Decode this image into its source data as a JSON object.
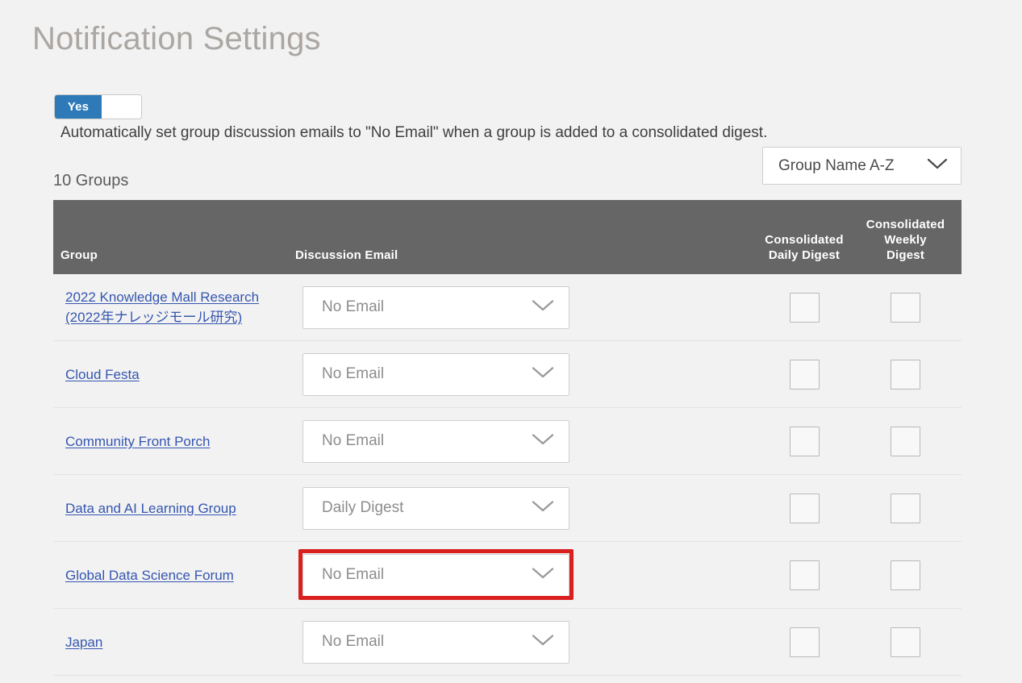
{
  "page": {
    "title": "Notification Settings"
  },
  "auto_setting": {
    "toggle_label": "Yes",
    "toggle_state": "on",
    "description": "Automatically set group discussion emails to \"No Email\" when a group is added to a consolidated digest."
  },
  "sort": {
    "selected": "Group Name A-Z",
    "icon": "chevron-down-icon"
  },
  "summary": {
    "count_label": "10 Groups"
  },
  "table": {
    "headers": {
      "group": "Group",
      "discussion_email": "Discussion Email",
      "consolidated_daily_digest": "Consolidated\nDaily Digest",
      "consolidated_daily_digest_line1": "Consolidated",
      "consolidated_daily_digest_line2": "Daily Digest",
      "consolidated_weekly_digest_line1": "Consolidated",
      "consolidated_weekly_digest_line2": "Weekly",
      "consolidated_weekly_digest_line3": "Digest"
    },
    "rows": [
      {
        "group": "2022 Knowledge Mall Research (2022年ナレッジモール研究)",
        "discussion_email": "No Email",
        "daily_digest_checked": false,
        "weekly_digest_checked": false,
        "highlighted": false
      },
      {
        "group": "Cloud Festa",
        "discussion_email": "No Email",
        "daily_digest_checked": false,
        "weekly_digest_checked": false,
        "highlighted": false
      },
      {
        "group": "Community Front Porch",
        "discussion_email": "No Email",
        "daily_digest_checked": false,
        "weekly_digest_checked": false,
        "highlighted": false
      },
      {
        "group": "Data and AI Learning Group",
        "discussion_email": "Daily Digest",
        "daily_digest_checked": false,
        "weekly_digest_checked": false,
        "highlighted": false
      },
      {
        "group": "Global Data Science Forum",
        "discussion_email": "No Email",
        "daily_digest_checked": false,
        "weekly_digest_checked": false,
        "highlighted": true
      },
      {
        "group": "Japan",
        "discussion_email": "No Email",
        "daily_digest_checked": false,
        "weekly_digest_checked": false,
        "highlighted": false
      }
    ]
  },
  "colors": {
    "toggle_on": "#2e7ab8",
    "table_header_bg": "#666666",
    "link": "#3556b0",
    "highlight_border": "#d9201f",
    "page_bg": "#f2f2f2",
    "title": "#aba6a2"
  }
}
